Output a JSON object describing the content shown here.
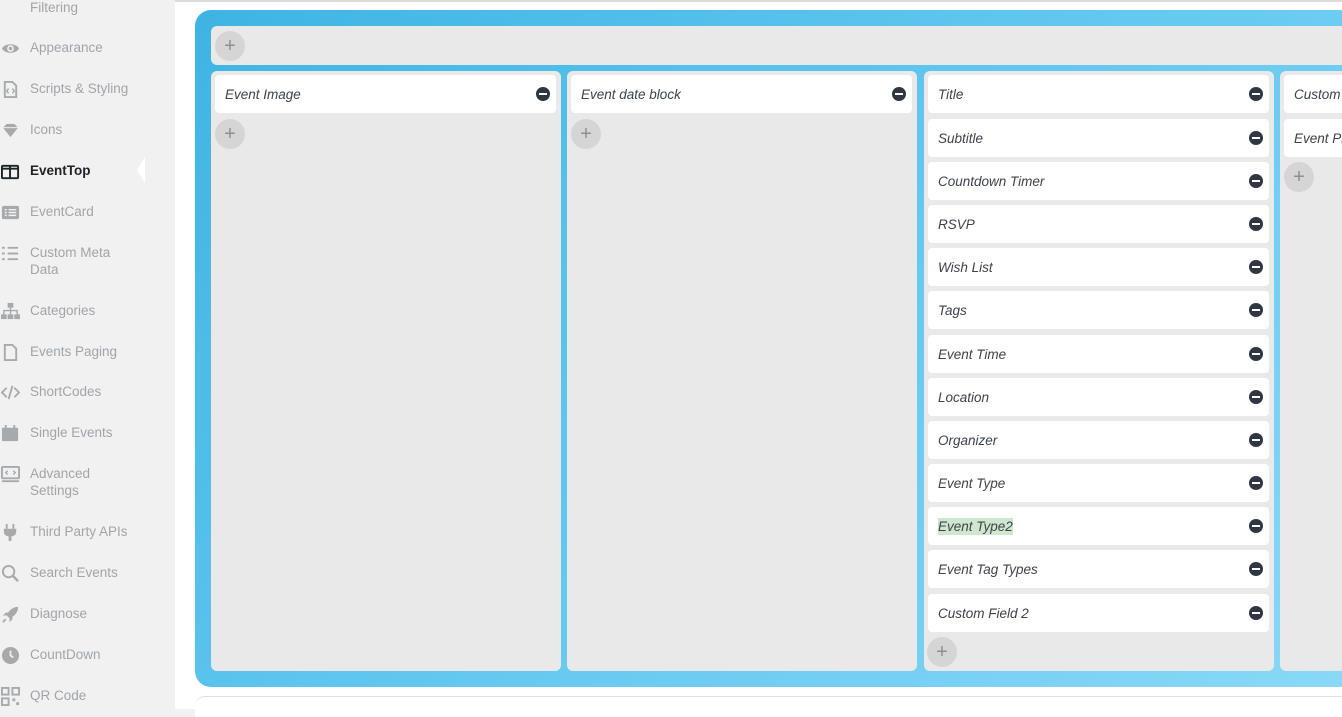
{
  "sidebar": {
    "items": [
      {
        "label": "Filtering",
        "icon": "filter-icon"
      },
      {
        "label": "Appearance",
        "icon": "eye-icon"
      },
      {
        "label": "Scripts & Styling",
        "icon": "code-file-icon"
      },
      {
        "label": "Icons",
        "icon": "diamond-icon"
      },
      {
        "label": "EventTop",
        "icon": "columns-icon",
        "active": true
      },
      {
        "label": "EventCard",
        "icon": "list-card-icon"
      },
      {
        "label": "Custom Meta Data",
        "icon": "list-icon"
      },
      {
        "label": "Categories",
        "icon": "sitemap-icon"
      },
      {
        "label": "Events Paging",
        "icon": "file-icon"
      },
      {
        "label": "ShortCodes",
        "icon": "code-icon"
      },
      {
        "label": "Single Events",
        "icon": "calendar-icon"
      },
      {
        "label": "Advanced Settings",
        "icon": "monitor-code-icon"
      },
      {
        "label": "Third Party APIs",
        "icon": "plug-icon"
      },
      {
        "label": "Search Events",
        "icon": "search-icon"
      },
      {
        "label": "Diagnose",
        "icon": "rocket-icon"
      },
      {
        "label": "CountDown",
        "icon": "clock-icon"
      },
      {
        "label": "QR Code",
        "icon": "qr-code-icon"
      }
    ]
  },
  "layout": {
    "add_symbol": "+",
    "columns": [
      {
        "fields": [
          "Event Image"
        ]
      },
      {
        "fields": [
          "Event date block"
        ]
      },
      {
        "fields": [
          "Title",
          "Subtitle",
          "Countdown Timer",
          "RSVP",
          "Wish List",
          "Tags",
          "Event Time",
          "Location",
          "Organizer",
          "Event Type",
          "Event Type2",
          "Event Tag Types",
          "Custom Field 2"
        ]
      },
      {
        "fields": [
          "Custom",
          "Event Pr"
        ]
      }
    ]
  },
  "colors": {
    "accent_gradient_start": "#3eb4e3",
    "accent_gradient_end": "#8ad8f7",
    "active_text": "#1d2327",
    "inactive_text": "#a0a5aa",
    "highlight": "#cfe7cf"
  }
}
